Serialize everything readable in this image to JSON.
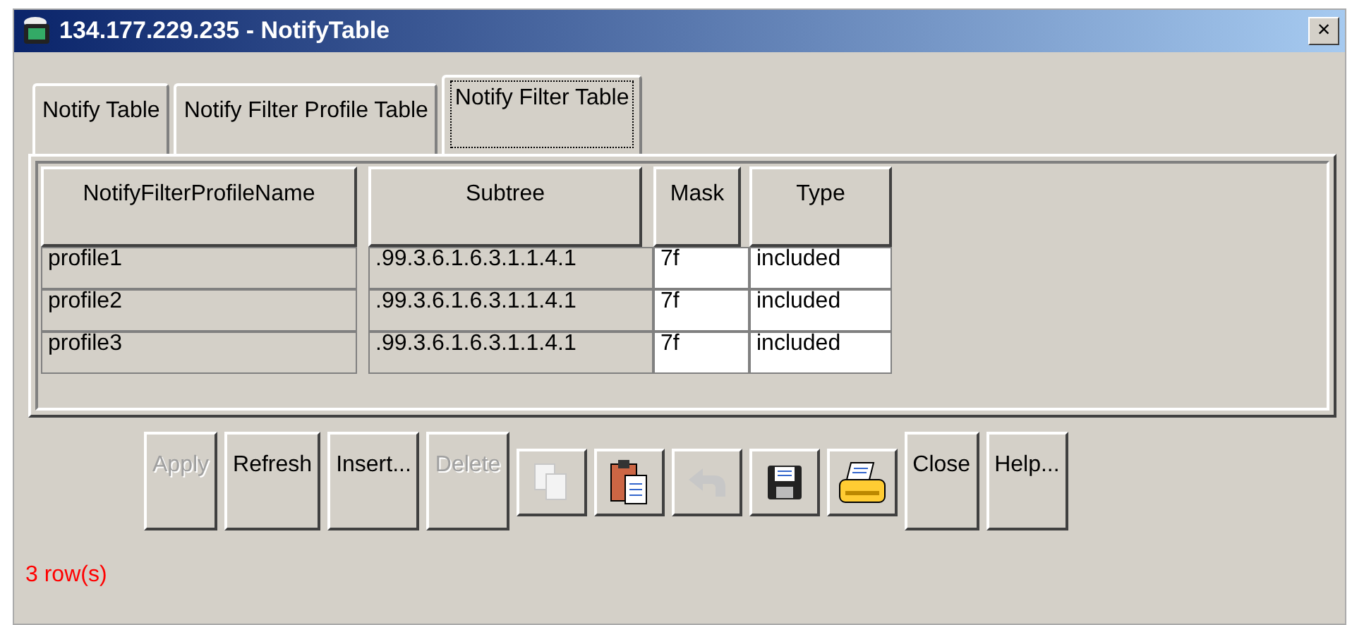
{
  "window": {
    "title": "134.177.229.235 - NotifyTable",
    "close": "×"
  },
  "tabs": [
    {
      "label": "Notify Table",
      "selected": false
    },
    {
      "label": "Notify Filter Profile Table",
      "selected": false
    },
    {
      "label": "Notify Filter Table",
      "selected": true
    }
  ],
  "table": {
    "columns": [
      {
        "label": "NotifyFilterProfileName",
        "editable": false
      },
      {
        "label": "Subtree",
        "editable": false
      },
      {
        "label": "Mask",
        "editable": true
      },
      {
        "label": "Type",
        "editable": true
      }
    ],
    "rows": [
      [
        "profile1",
        ".99.3.6.1.6.3.1.1.4.1",
        "7f",
        "included"
      ],
      [
        "profile2",
        ".99.3.6.1.6.3.1.1.4.1",
        "7f",
        "included"
      ],
      [
        "profile3",
        ".99.3.6.1.6.3.1.1.4.1",
        "7f",
        "included"
      ]
    ]
  },
  "buttons": [
    {
      "kind": "text",
      "label": "Apply",
      "disabled": true
    },
    {
      "kind": "text",
      "label": "Refresh",
      "disabled": false
    },
    {
      "kind": "text",
      "label": "Insert...",
      "disabled": false
    },
    {
      "kind": "text",
      "label": "Delete",
      "disabled": true
    },
    {
      "kind": "icon",
      "disabled": true
    },
    {
      "kind": "icon",
      "disabled": false
    },
    {
      "kind": "icon",
      "disabled": true
    },
    {
      "kind": "icon",
      "disabled": false
    },
    {
      "kind": "icon",
      "disabled": false
    },
    {
      "kind": "text",
      "label": "Close",
      "disabled": false
    },
    {
      "kind": "text",
      "label": "Help...",
      "disabled": false
    }
  ],
  "status_bar": "3 row(s)"
}
